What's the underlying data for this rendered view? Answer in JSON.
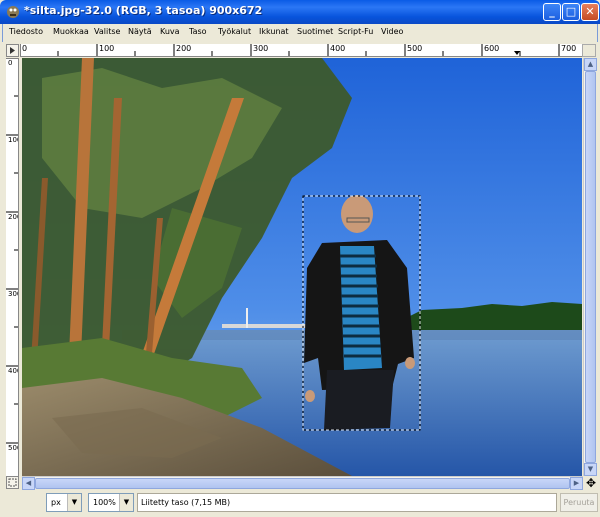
{
  "window": {
    "title": "*silta.jpg-32.0 (RGB, 3 tasoa) 900x672",
    "minimize_glyph": "_",
    "maximize_glyph": "□",
    "close_glyph": "✕"
  },
  "menubar": {
    "items": [
      "Tiedosto",
      "Muokkaa",
      "Valitse",
      "Näytä",
      "Kuva",
      "Taso",
      "Työkalut",
      "Ikkunat",
      "Suotimet",
      "Script-Fu",
      "Video"
    ]
  },
  "rulers": {
    "horizontal": [
      "0",
      "100",
      "200",
      "300",
      "400",
      "500",
      "600",
      "700"
    ],
    "vertical": [
      "0",
      "100",
      "200",
      "300",
      "400",
      "500"
    ]
  },
  "statusbar": {
    "unit": "px",
    "zoom": "100%",
    "message": "Liitetty taso (7,15 MB)",
    "cancel_label": "Peruuta"
  },
  "icons": {
    "app": "gimp-icon",
    "corner": "menu-arrow-icon",
    "quickmask": "quick-mask-icon",
    "navigate": "navigate-icon"
  }
}
